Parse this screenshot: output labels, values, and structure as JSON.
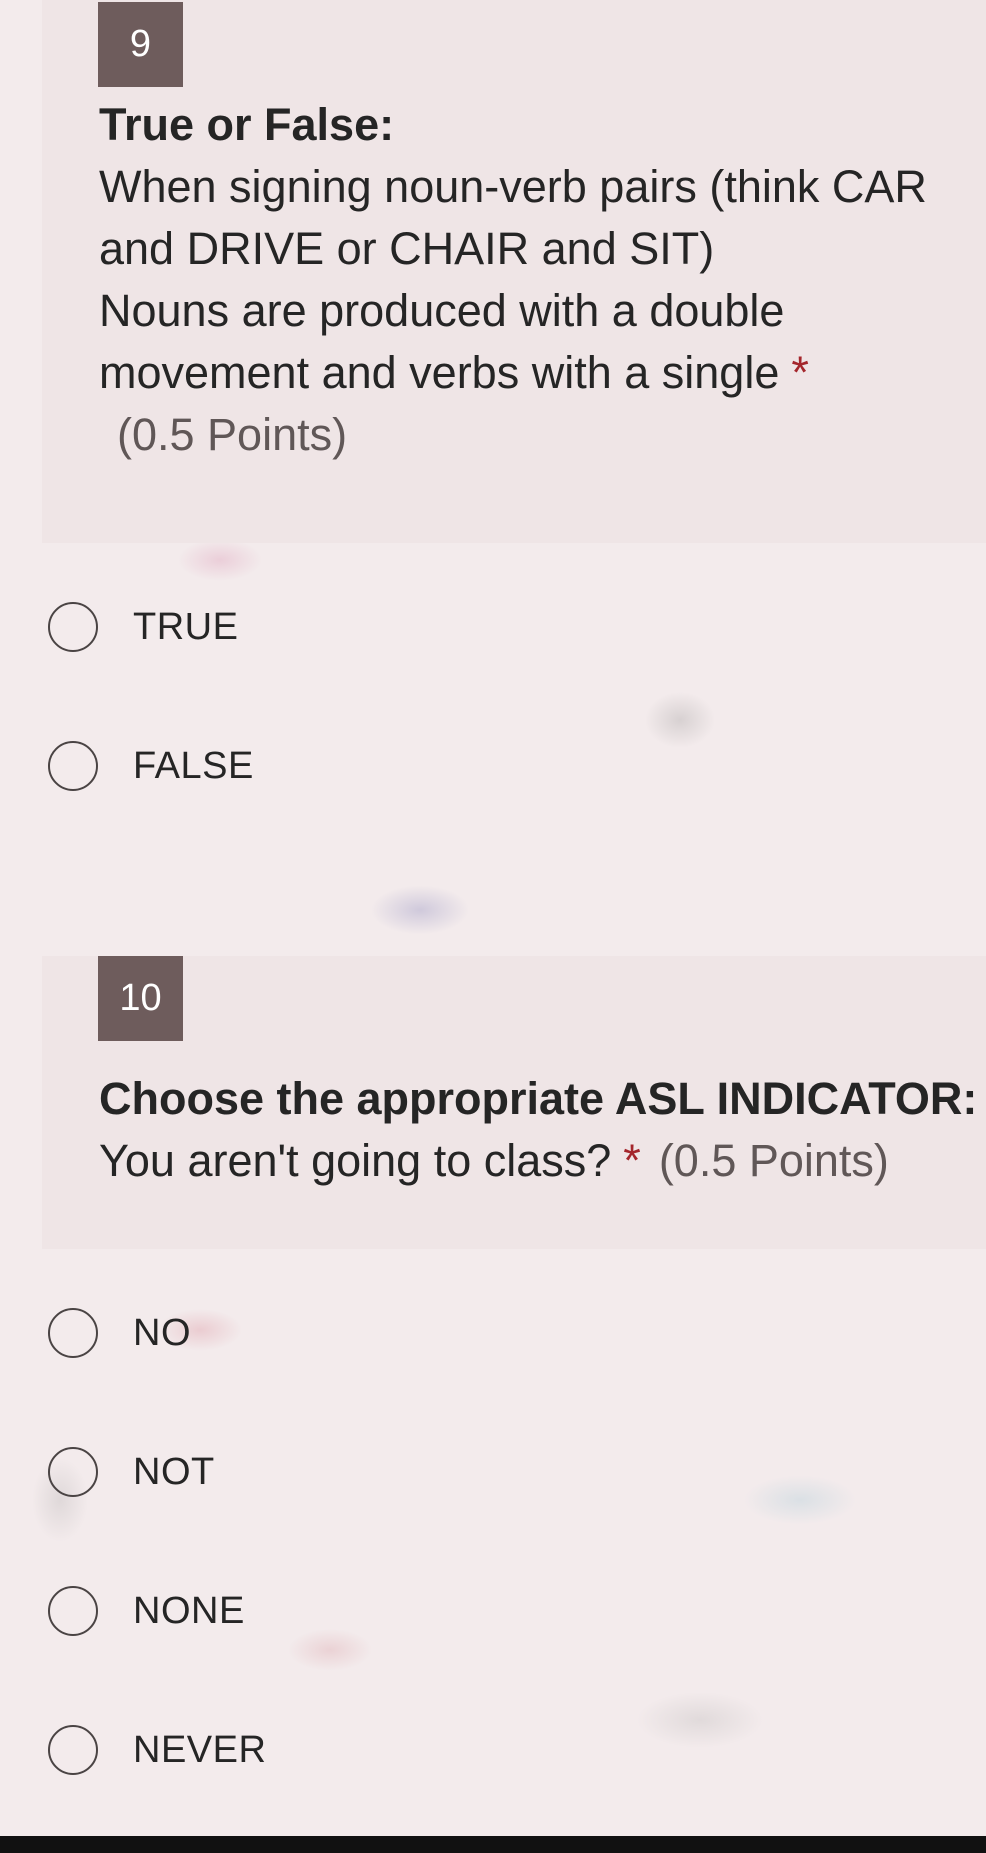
{
  "questions": [
    {
      "number": "9",
      "title": "True or False:",
      "lines": [
        "When signing noun-verb pairs (think CAR",
        "and DRIVE or CHAIR and SIT)",
        "Nouns are produced with a double",
        "movement and verbs with a single"
      ],
      "required_mark": "*",
      "points": "(0.5 Points)",
      "options": [
        "TRUE",
        "FALSE"
      ]
    },
    {
      "number": "10",
      "title": "Choose the appropriate ASL INDICATOR:",
      "lines": [
        "You aren't going to class?"
      ],
      "required_mark": "*",
      "points": "(0.5 Points)",
      "options": [
        "NO",
        "NOT",
        "NONE",
        "NEVER"
      ]
    }
  ],
  "colors": {
    "number_badge": "#6e5c5c",
    "required": "#a4262c",
    "card": "#efe5e6"
  }
}
